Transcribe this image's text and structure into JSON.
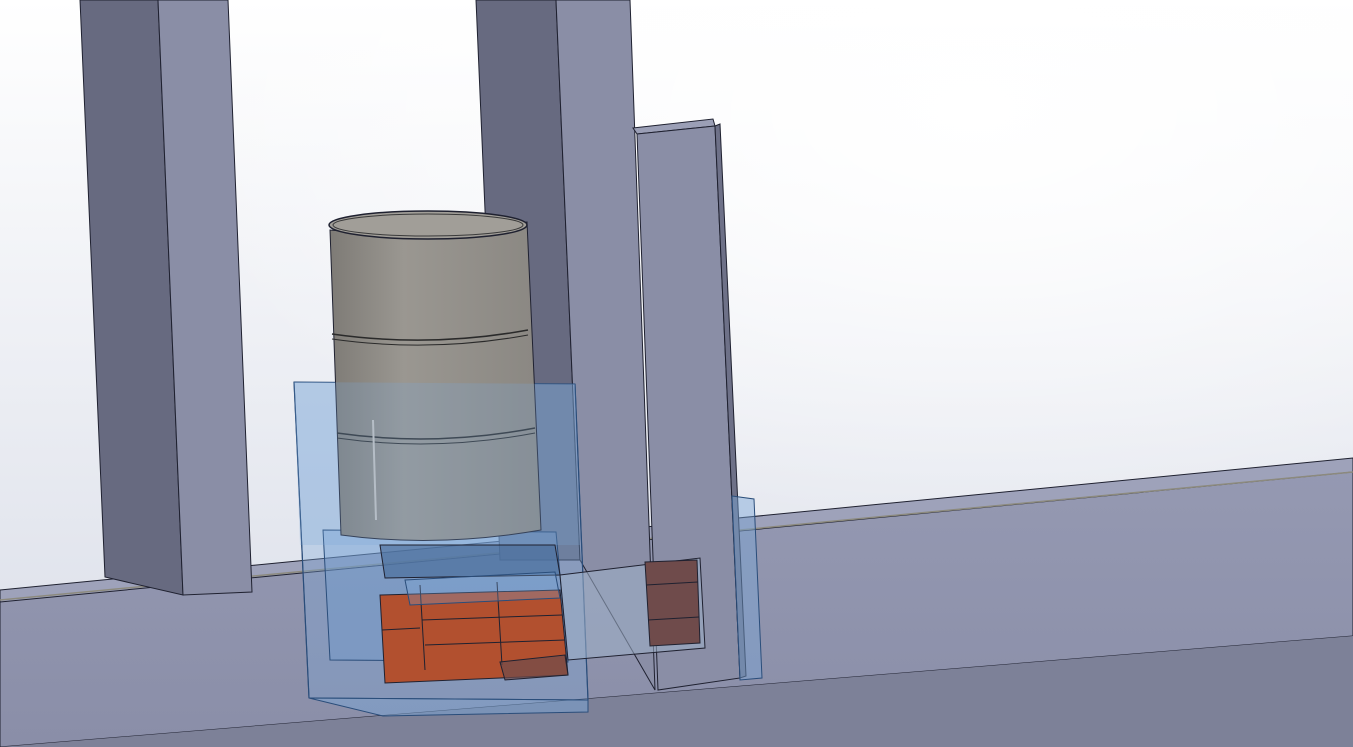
{
  "app": "CAD 3D viewport",
  "scene": {
    "background": {
      "top": "#ffffff",
      "bottom": "#d9dde8"
    },
    "colors": {
      "frame_light": "#8a8ea6",
      "frame_dark": "#676a80",
      "frame_top": "#9b9fb6",
      "beam_face": "#8f93ac",
      "beam_bottom": "#7d8198",
      "edge": "#1f2130",
      "drum_body": "#8f8c87",
      "drum_top": "#a19e98",
      "housing_glass": "#7aa6d6",
      "housing_edge": "#2a4d7a",
      "brick": "#b2502f",
      "brick_dark": "#6f4b4b"
    },
    "components": [
      "left-column",
      "center-column",
      "right-post",
      "base-beam",
      "drum",
      "glass-housing",
      "motor-block",
      "side-bracket"
    ]
  }
}
